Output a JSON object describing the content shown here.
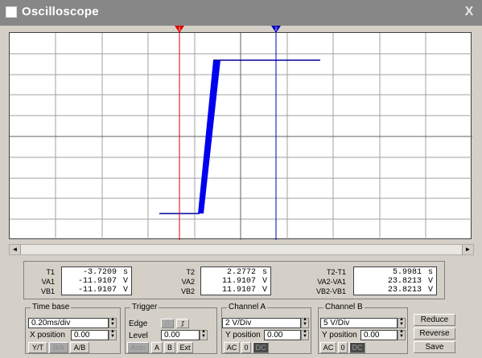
{
  "window": {
    "title": "Oscilloscope",
    "close_glyph": "X"
  },
  "cursors": {
    "t1_marker": "1",
    "t2_marker": "2"
  },
  "scroll": {
    "left": "◄",
    "right": "►"
  },
  "readout": {
    "t1": {
      "label": "T1",
      "value": "-3.7209",
      "unit": "s"
    },
    "va1": {
      "label": "VA1",
      "value": "-11.9107",
      "unit": "V"
    },
    "vb1": {
      "label": "VB1",
      "value": "-11.9107",
      "unit": "V"
    },
    "t2": {
      "label": "T2",
      "value": "2.2772",
      "unit": "s"
    },
    "va2": {
      "label": "VA2",
      "value": "11.9107",
      "unit": "V"
    },
    "vb2": {
      "label": "VB2",
      "value": "11.9107",
      "unit": "V"
    },
    "dt": {
      "label": "T2-T1",
      "value": "5.9981",
      "unit": "s"
    },
    "dva": {
      "label": "VA2-VA1",
      "value": "23.8213",
      "unit": "V"
    },
    "dvb": {
      "label": "VB2-VB1",
      "value": "23.8213",
      "unit": "V"
    }
  },
  "timebase": {
    "title": "Time base",
    "scale": "0.20ms/div",
    "xpos_label": "X position",
    "xpos": "0.00",
    "modes": [
      "Y/T",
      "B/A",
      "A/B"
    ]
  },
  "trigger": {
    "title": "Trigger",
    "edge_label": "Edge",
    "edge_rise": "⎍",
    "edge_fall": "⎎",
    "level_label": "Level",
    "level": "0.00",
    "sources": [
      "Auto",
      "A",
      "B",
      "Ext"
    ]
  },
  "channel_a": {
    "title": "Channel A",
    "scale": "2  V/Div",
    "ypos_label": "Y position",
    "ypos": "0.00",
    "coupling": [
      "AC",
      "0",
      "DC"
    ]
  },
  "channel_b": {
    "title": "Channel B",
    "scale": "5  V/Div",
    "ypos_label": "Y position",
    "ypos": "0.00",
    "coupling": [
      "AC",
      "0",
      "DC"
    ]
  },
  "actions": {
    "reduce": "Reduce",
    "reverse": "Reverse",
    "save": "Save"
  },
  "colors": {
    "trace": "#0000e0",
    "cursor1": "#e00000",
    "cursor2": "#0000c0",
    "grid": "#909090"
  }
}
